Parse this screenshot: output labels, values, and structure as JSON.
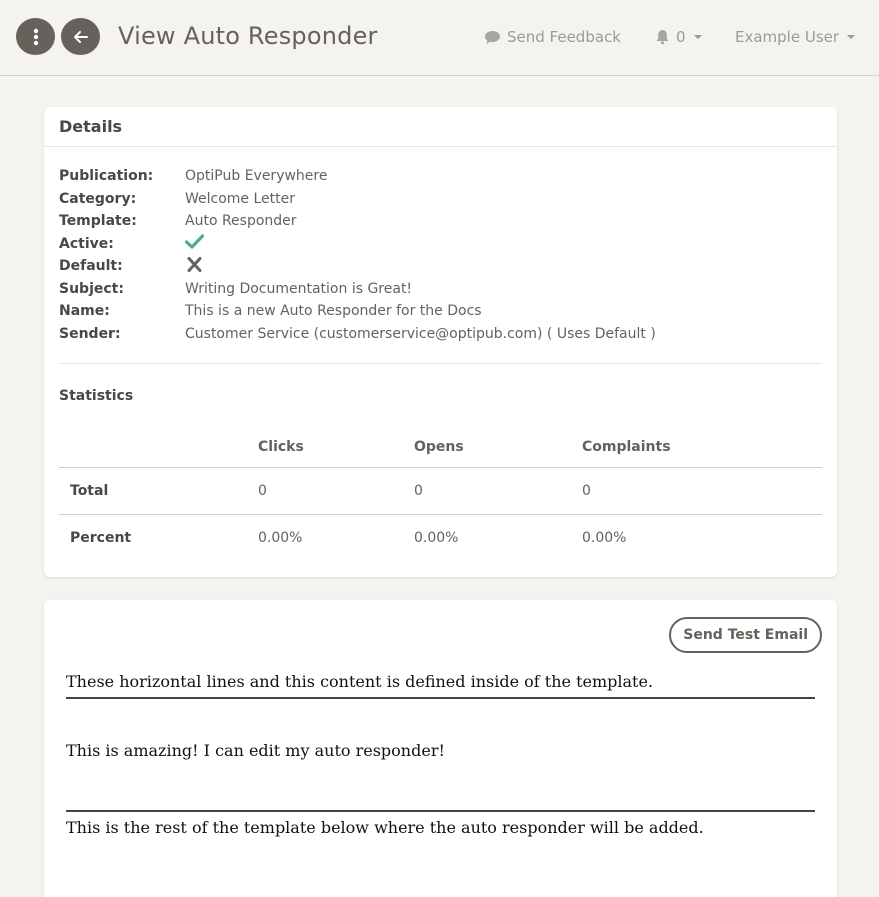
{
  "header": {
    "title": "View Auto Responder",
    "feedback_label": "Send Feedback",
    "notification_count": "0",
    "user_name": "Example User"
  },
  "details": {
    "card_title": "Details",
    "rows": [
      {
        "label": "Publication:",
        "value": "OptiPub Everywhere"
      },
      {
        "label": "Category:",
        "value": "Welcome Letter"
      },
      {
        "label": "Template:",
        "value": "Auto Responder"
      },
      {
        "label": "Active:",
        "value": ""
      },
      {
        "label": "Default:",
        "value": ""
      },
      {
        "label": "Subject:",
        "value": "Writing Documentation is Great!"
      },
      {
        "label": "Name:",
        "value": "This is a new Auto Responder for the Docs"
      },
      {
        "label": "Sender:",
        "value": "Customer Service (customerservice@optipub.com) ( Uses Default )"
      }
    ],
    "active_icon": "check-icon",
    "default_icon": "x-icon",
    "active_color": "#4caf7d"
  },
  "statistics": {
    "title": "Statistics",
    "columns": [
      "",
      "Clicks",
      "Opens",
      "Complaints"
    ],
    "rows": [
      {
        "label": "Total",
        "clicks": "0",
        "opens": "0",
        "complaints": "0"
      },
      {
        "label": "Percent",
        "clicks": "0.00%",
        "opens": "0.00%",
        "complaints": "0.00%"
      }
    ]
  },
  "email_preview": {
    "send_test_label": "Send Test Email",
    "line1": "These horizontal lines and this content is defined inside of the template.",
    "line2": "This is amazing! I can edit my auto responder!",
    "line3": "This is the rest of the template below where the auto responder will be added."
  },
  "colors": {
    "background": "#f4f3ef",
    "primary_dark": "#66615b",
    "card": "#ffffff"
  }
}
